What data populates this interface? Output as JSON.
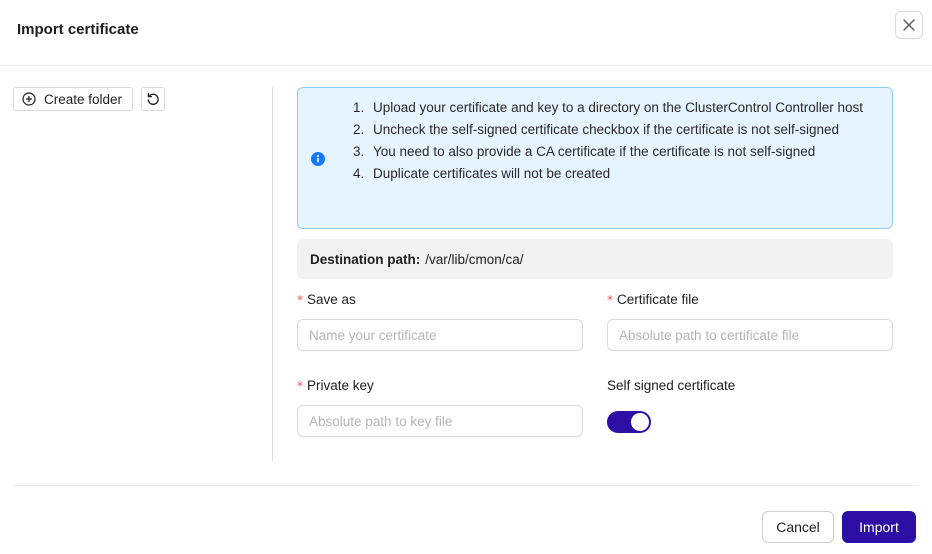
{
  "dialog": {
    "title": "Import certificate"
  },
  "toolbar": {
    "create_folder_label": "Create folder"
  },
  "info": {
    "items": [
      {
        "num": "1.",
        "text": "Upload your certificate and key to a directory on the ClusterControl Controller host"
      },
      {
        "num": "2.",
        "text": "Uncheck the self-signed certificate checkbox if the certificate is not self-signed"
      },
      {
        "num": "3.",
        "text": "You need to also provide a CA certificate if the certificate is not self-signed"
      },
      {
        "num": "4.",
        "text": "Duplicate certificates will not be created"
      }
    ]
  },
  "destination": {
    "label": "Destination path:",
    "path": "/var/lib/cmon/ca/"
  },
  "form": {
    "save_as": {
      "label": "Save as",
      "required": "*",
      "value": "",
      "placeholder": "Name your certificate"
    },
    "certificate_file": {
      "label": "Certificate file",
      "required": "*",
      "value": "",
      "placeholder": "Absolute path to certificate file"
    },
    "private_key": {
      "label": "Private key",
      "required": "*",
      "value": "",
      "placeholder": "Absolute path to key file"
    },
    "self_signed": {
      "label": "Self signed certificate",
      "checked": true
    }
  },
  "footer": {
    "cancel_label": "Cancel",
    "import_label": "Import"
  },
  "colors": {
    "primary": "#2d0fa5",
    "info_bg": "#e6f4ff",
    "info_border": "#91caff",
    "info_icon": "#1677ff",
    "required": "#ff4d4f"
  },
  "icons": {
    "close": "close-icon",
    "create_folder": "plus-circle-icon",
    "refresh": "refresh-icon",
    "info": "info-icon"
  }
}
